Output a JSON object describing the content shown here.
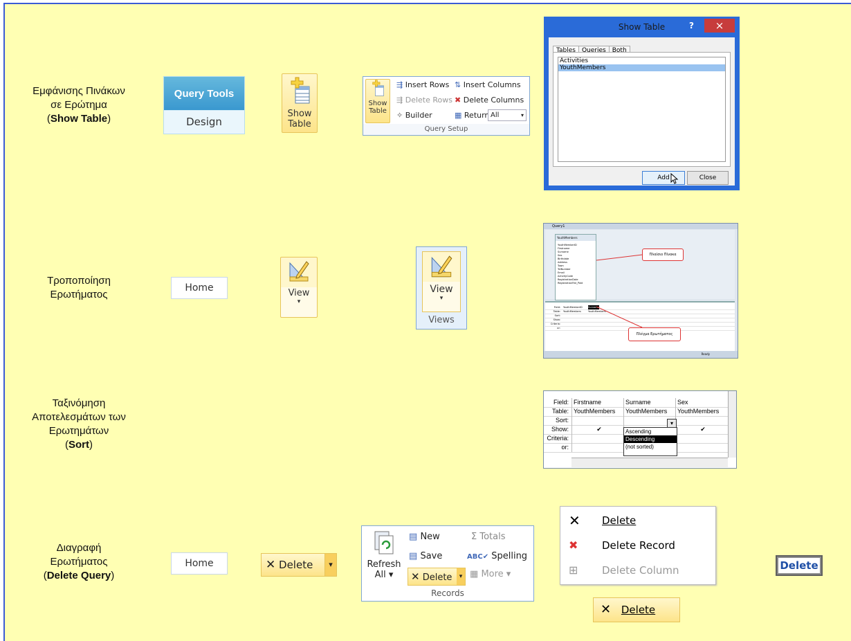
{
  "labels": {
    "row1_line1": "Εμφάνισης Πινάκων",
    "row1_line2": "σε Ερώτημα",
    "row1_bold": "Show Table",
    "row2_line1": "Τροποποίηση",
    "row2_line2": "Ερωτήματος",
    "row3_line1": "Ταξινόμηση",
    "row3_line2": "Αποτελεσμάτων των",
    "row3_line3": "Ερωτημάτων",
    "row3_bold": "Sort",
    "row4_line1": "Διαγραφή",
    "row4_line2": "Ερωτήματος",
    "row4_bold": "Delete Query",
    "open_paren": "(",
    "close_paren": ")"
  },
  "query_tools": {
    "header": "Query Tools",
    "tab": "Design"
  },
  "show_table_button": {
    "line1": "Show",
    "line2": "Table"
  },
  "query_setup": {
    "show": "Show",
    "table": "Table",
    "insert_rows": "Insert Rows",
    "delete_rows": "Delete Rows",
    "builder": "Builder",
    "insert_columns": "Insert Columns",
    "delete_columns": "Delete Columns",
    "return_label": "Return:",
    "return_value": "All",
    "group_label": "Query Setup"
  },
  "show_table_dialog": {
    "title": "Show Table",
    "help": "?",
    "close_x": "×",
    "tabs": [
      "Tables",
      "Queries",
      "Both"
    ],
    "items": [
      "Activities",
      "YouthMembers"
    ],
    "add": "Add",
    "close": "Close"
  },
  "home_tab": "Home",
  "view_button": {
    "label": "View",
    "arrow": "▾"
  },
  "views_group": {
    "label": "View",
    "arrow": "▾",
    "group": "Views"
  },
  "design_view": {
    "window_title": "Query1",
    "table_title": "YouthMembers",
    "fields": [
      "YouthMemberID",
      "Firstname",
      "Surname",
      "Sex",
      "Birthdate",
      "Address",
      "Town",
      "TelNumber",
      "Email",
      "ActivityCode",
      "RegistrationDate",
      "RegistrationFee_Paid"
    ],
    "callout_table": "Πλαίσιο Πίνακα",
    "callout_grid": "Πλέγμα Ερωτήματος",
    "grid_rows": [
      "Field:",
      "Table:",
      "Sort:",
      "Show:",
      "Criteria:",
      "or:"
    ],
    "grid_col1_field": "YouthMemberID",
    "grid_col1_table": "YouthMembers",
    "grid_col2_field": "Surname",
    "grid_col2_table": "YouthMembers",
    "status": "Ready"
  },
  "sort_grid": {
    "row_labels": [
      "Field:",
      "Table:",
      "Sort:",
      "Show:",
      "Criteria:",
      "or:"
    ],
    "columns": [
      {
        "field": "Firstname",
        "table": "YouthMembers"
      },
      {
        "field": "Surname",
        "table": "YouthMembers"
      },
      {
        "field": "Sex",
        "table": "YouthMembers"
      }
    ],
    "check": "✔",
    "options": [
      "Ascending",
      "Descending",
      "(not sorted)"
    ],
    "selected": "Descending"
  },
  "delete_button": {
    "label": "Delete",
    "arrow": "▾"
  },
  "records_group": {
    "refresh": "Refresh",
    "all": "All ▾",
    "new": "New",
    "save": "Save",
    "delete": "Delete",
    "totals": "Totals",
    "spelling": "Spelling",
    "more": "More ▾",
    "group": "Records"
  },
  "context_menu": {
    "items": [
      "Delete",
      "Delete Record",
      "Delete Column"
    ]
  },
  "delete_small": "Delete",
  "delete_key": "Delete",
  "colors": {
    "panel": "#ffffb3",
    "border": "#3b5bd5",
    "accent": "#2a6bd8",
    "ribbon_hover": "#fde48a"
  }
}
